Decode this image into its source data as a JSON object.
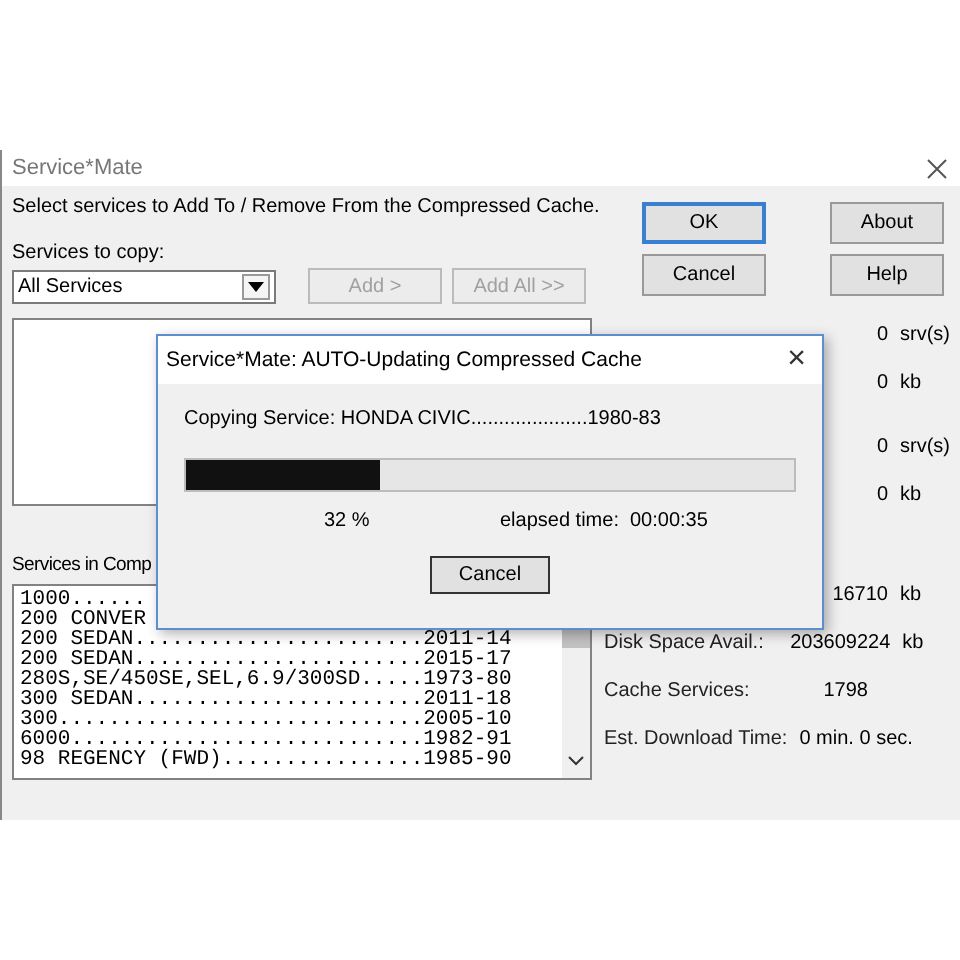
{
  "window": {
    "title": "Service*Mate"
  },
  "instruction": "Select services to Add To / Remove From the Compressed Cache.",
  "copy_label": "Services to copy:",
  "dropdown": {
    "value": "All Services"
  },
  "add_buttons": [
    {
      "label": "Add >",
      "disabled": true
    },
    {
      "label": "Add All >>",
      "disabled": true
    }
  ],
  "buttons": [
    {
      "label": "OK",
      "default": true
    },
    {
      "label": "About",
      "default": false
    },
    {
      "label": "Cancel",
      "default": false
    },
    {
      "label": "Help",
      "default": false
    }
  ],
  "compressed_label": "Services in Comp",
  "services": [
    "1000......",
    "200 CONVER",
    "200 SEDAN.......................2011-14",
    "200 SEDAN.......................2015-17",
    "280S,SE/450SE,SEL,6.9/300SD.....1973-80",
    "300 SEDAN.......................2011-18",
    "300.............................2005-10",
    "6000............................1982-91",
    "98 REGENCY (FWD)................1985-90"
  ],
  "stats": [
    {
      "value": "0",
      "unit": "srv(s)"
    },
    {
      "value": "0",
      "unit": "kb"
    },
    {
      "value": "0",
      "unit": "srv(s)"
    },
    {
      "value": "0",
      "unit": "kb"
    },
    {
      "value": "16710",
      "unit": "kb"
    },
    {
      "label": "Disk Space Avail.:",
      "value": "203609224",
      "unit": "kb"
    },
    {
      "label": "Cache Services:",
      "value": "1798"
    },
    {
      "label": "Est. Download Time:",
      "value": "0 min. 0 sec."
    }
  ],
  "progress_dialog": {
    "title": "Service*Mate:  AUTO-Updating Compressed Cache",
    "close": "×",
    "message": "Copying Service: HONDA CIVIC.....................1980-83",
    "level": 0.32,
    "percent": "32  %",
    "elapsed_label": "elapsed time:",
    "elapsed": "00:00:35",
    "button": "Cancel"
  }
}
